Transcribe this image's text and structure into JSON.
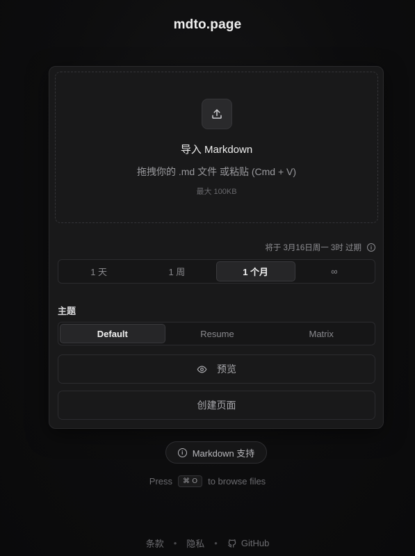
{
  "brand": "mdto.page",
  "dropzone": {
    "icon": "upload-icon",
    "title": "导入 Markdown",
    "hint": "拖拽你的 .md 文件 或粘贴 (Cmd + V)",
    "limit": "最大 100KB"
  },
  "expiry": {
    "note": "将于 3月16日周一 3时 过期",
    "options": [
      "1 天",
      "1 周",
      "1 个月",
      "∞"
    ],
    "selected": "1 个月"
  },
  "theme": {
    "label": "主题",
    "options": [
      "Default",
      "Resume",
      "Matrix"
    ],
    "selected": "Default"
  },
  "preview_label": "预览",
  "create_label": "创建页面",
  "support_label": "Markdown 支持",
  "press": {
    "before": "Press",
    "key": "⌘ O",
    "after": "to browse files"
  },
  "footer": {
    "terms": "条款",
    "privacy": "隐私",
    "github": "GitHub"
  },
  "colors": {
    "background": "#0b0b0c",
    "card": "#19191a",
    "active_segment": "#262628"
  }
}
